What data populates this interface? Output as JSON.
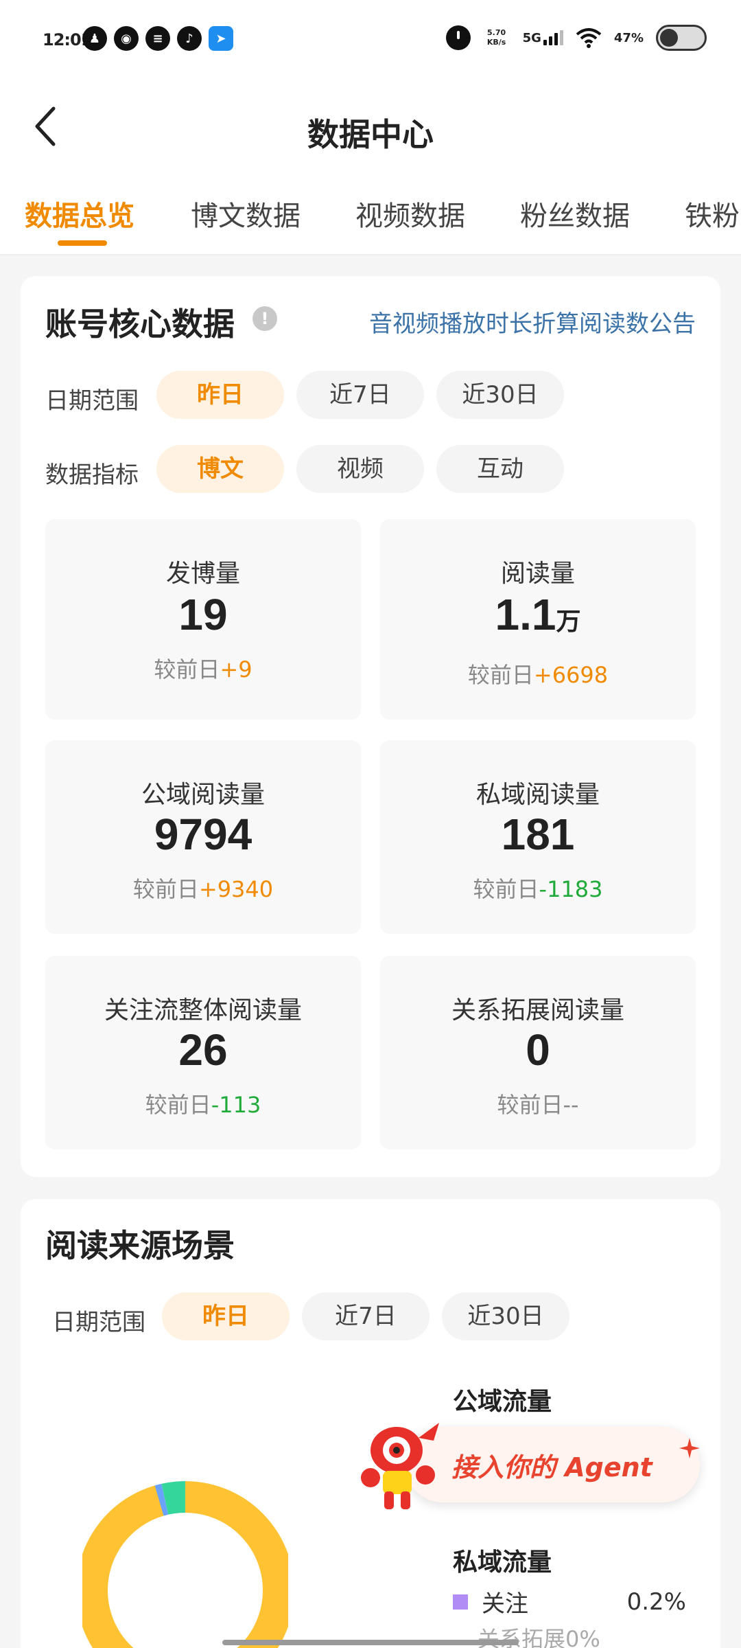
{
  "status_bar": {
    "time": "12:01",
    "net_speed_value": "5.70",
    "net_speed_unit": "KB/s",
    "network": "5G",
    "battery": "47%",
    "app_icons": [
      "qq-icon",
      "weibo-icon",
      "lantern-icon",
      "tiktok-icon",
      "bluemsg-icon"
    ]
  },
  "header": {
    "title": "数据中心"
  },
  "tabs": [
    {
      "label": "数据总览",
      "active": true
    },
    {
      "label": "博文数据",
      "active": false
    },
    {
      "label": "视频数据",
      "active": false
    },
    {
      "label": "粉丝数据",
      "active": false
    },
    {
      "label": "铁粉",
      "active": false
    }
  ],
  "core": {
    "title": "账号核心数据",
    "info_icon": "!",
    "notice_link": "音视频播放时长折算阅读数公告",
    "date_label": "日期范围",
    "date_options": [
      "昨日",
      "近7日",
      "近30日"
    ],
    "date_selected": "昨日",
    "metric_label": "数据指标",
    "metric_options": [
      "博文",
      "视频",
      "互动"
    ],
    "metric_selected": "博文",
    "delta_prefix": "较前日",
    "stats": [
      {
        "label": "发博量",
        "value": "19",
        "unit": "",
        "delta": "+9",
        "trend": "up"
      },
      {
        "label": "阅读量",
        "value": "1.1",
        "unit": "万",
        "delta": "+6698",
        "trend": "up"
      },
      {
        "label": "公域阅读量",
        "value": "9794",
        "unit": "",
        "delta": "+9340",
        "trend": "up"
      },
      {
        "label": "私域阅读量",
        "value": "181",
        "unit": "",
        "delta": "-1183",
        "trend": "down"
      },
      {
        "label": "关注流整体阅读量",
        "value": "26",
        "unit": "",
        "delta": "-113",
        "trend": "down"
      },
      {
        "label": "关系拓展阅读量",
        "value": "0",
        "unit": "",
        "delta": "--",
        "trend": "none"
      }
    ]
  },
  "source": {
    "title": "阅读来源场景",
    "date_label": "日期范围",
    "date_options": [
      "昨日",
      "近7日",
      "近30日"
    ],
    "date_selected": "昨日",
    "public_heading": "公域流量",
    "private_heading": "私域流量",
    "private_items": [
      {
        "label": "关注",
        "percent": "0.2%",
        "color": "#b28cf5"
      }
    ],
    "faded_item": "关系拓展0%",
    "donut_segments": [
      {
        "color": "#ffc233",
        "fraction": 0.955
      },
      {
        "color": "#6aa2ff",
        "fraction": 0.01
      },
      {
        "color": "#35d69c",
        "fraction": 0.035
      }
    ]
  },
  "agent_promo": {
    "text": "接入你的 Agent"
  },
  "colors": {
    "accent": "#f08a00",
    "up": "#f08a00",
    "down": "#1faa3a",
    "link": "#3b72a8"
  }
}
